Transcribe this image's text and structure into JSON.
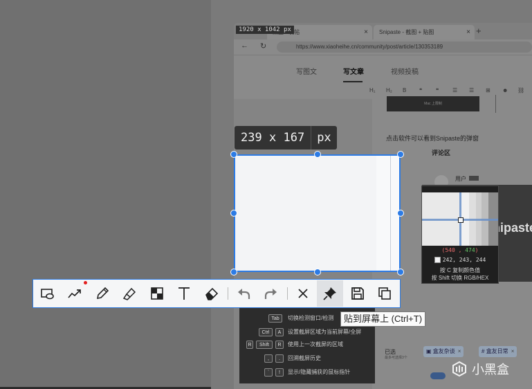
{
  "screen_size": "1920 x 1042 px",
  "browser": {
    "tabs": [
      {
        "label": "黑盒 - 发帖",
        "close": "×"
      },
      {
        "label": "Snipaste - 截图 + 贴图",
        "close": "×"
      }
    ],
    "new_tab": "+",
    "nav": {
      "back": "←",
      "reload": "↻"
    },
    "url": "https://www.xiaoheihe.cn/community/post/article/130353189",
    "page_tabs": [
      "写图文",
      "写文章",
      "视频投稿"
    ],
    "active_page_tab": "写文章",
    "editor_tools": [
      "H₁",
      "H₂",
      "B",
      "❝",
      "❝",
      "☰",
      "☰",
      "⊞",
      "☻",
      "⛓",
      "▣",
      "▣"
    ],
    "banner_text": "Mac 上限制",
    "heading": "点击软件可以看到Snipaste的弹窗",
    "comment_title": "评论区",
    "user_label": "用户",
    "panel_text": "nipaste",
    "selected_label": "已选",
    "selected_sub": "最多可选择3个",
    "chips": [
      {
        "icon": "▣",
        "label": "盒友杂谈",
        "close": "×"
      },
      {
        "icon": "#",
        "label": "盒友日常",
        "close": "×"
      }
    ]
  },
  "hints": [
    {
      "keys": [
        "Tab"
      ],
      "text": "切换检测窗口/检测"
    },
    {
      "keys": [
        "Ctrl",
        "A"
      ],
      "text": "设置截屏区域为当前屏幕/全屏"
    },
    {
      "keys": [
        "R",
        "Shift",
        "R"
      ],
      "text": "使用上一次截屏的区域"
    },
    {
      "keys": [
        ",",
        "."
      ],
      "text": "回溯截屏历史"
    },
    {
      "keys": [
        "`",
        "!"
      ],
      "text": "显示/隐藏捕获的鼠标指针"
    }
  ],
  "selection": {
    "width": "239",
    "x": "x",
    "height": "167",
    "unit": "px"
  },
  "magnifier": {
    "coord_x": "540",
    "coord_y": "474",
    "rgb": "242, 243, 244",
    "hint1": "按 C 复制颜色值",
    "hint2": "按 Shift 切换 RGB/HEX"
  },
  "toolbar": {
    "tools": [
      {
        "name": "shape-tool",
        "icon": "shape-icon",
        "tooltip": ""
      },
      {
        "name": "marker-line-tool",
        "icon": "trend-line-icon",
        "tooltip": ""
      },
      {
        "name": "pencil-tool",
        "icon": "pencil-icon",
        "tooltip": ""
      },
      {
        "name": "highlighter-tool",
        "icon": "highlighter-icon",
        "tooltip": ""
      },
      {
        "name": "mosaic-tool",
        "icon": "mosaic-icon",
        "tooltip": ""
      },
      {
        "name": "text-tool",
        "icon": "text-icon",
        "tooltip": ""
      },
      {
        "name": "eraser-tool",
        "icon": "eraser-icon",
        "tooltip": ""
      },
      {
        "name": "undo-button",
        "icon": "undo-icon",
        "tooltip": ""
      },
      {
        "name": "redo-button",
        "icon": "redo-icon",
        "tooltip": ""
      },
      {
        "name": "cancel-button",
        "icon": "close-icon",
        "tooltip": ""
      },
      {
        "name": "pin-button",
        "icon": "pin-icon",
        "tooltip": "贴到屏幕上 (Ctrl+T)"
      },
      {
        "name": "save-button",
        "icon": "save-icon",
        "tooltip": ""
      },
      {
        "name": "copy-button",
        "icon": "copy-icon",
        "tooltip": ""
      }
    ],
    "tooltip": "贴到屏幕上 (Ctrl+T)",
    "accent_color": "#2c7be5",
    "notification_dot_color": "#e32020"
  },
  "watermark": "小黑盒"
}
